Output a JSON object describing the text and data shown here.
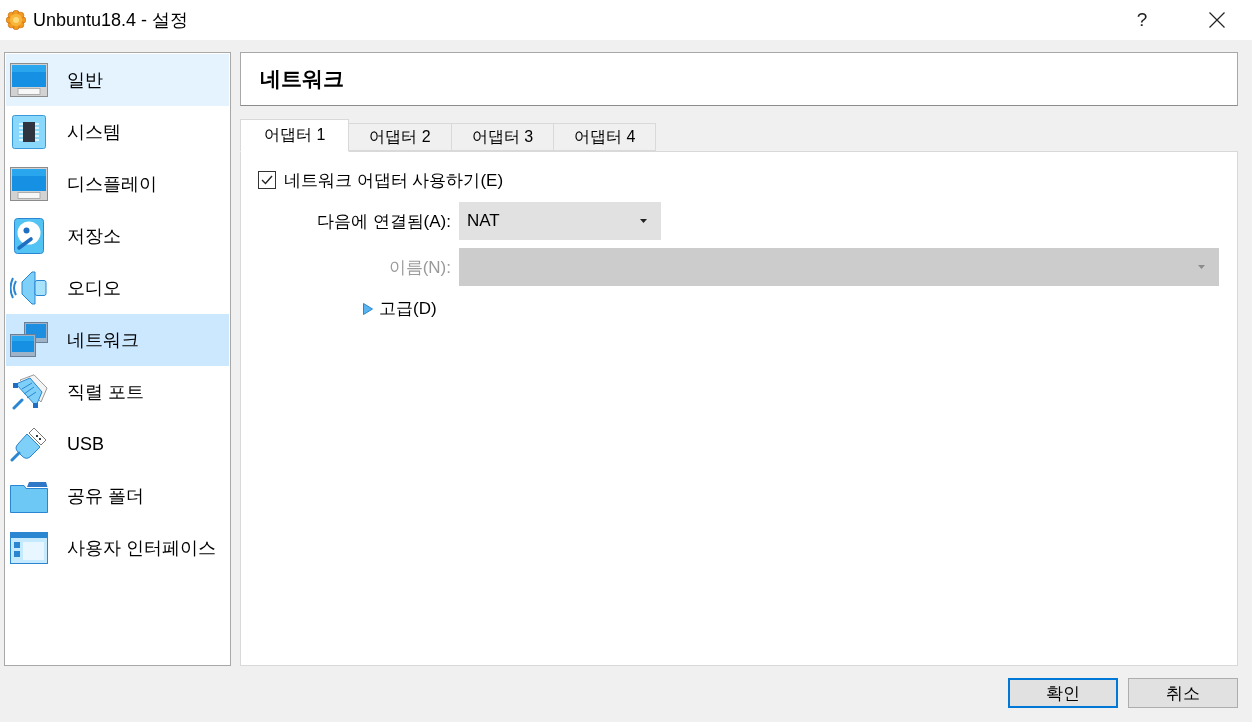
{
  "window": {
    "title": "Unbuntu18.4 - 설정",
    "help": "?"
  },
  "sidebar": {
    "items": [
      {
        "label": "일반",
        "kind": "general",
        "selected": false,
        "hovered": true
      },
      {
        "label": "시스템",
        "kind": "system",
        "selected": false,
        "hovered": false
      },
      {
        "label": "디스플레이",
        "kind": "display",
        "selected": false,
        "hovered": false
      },
      {
        "label": "저장소",
        "kind": "storage",
        "selected": false,
        "hovered": false
      },
      {
        "label": "오디오",
        "kind": "audio",
        "selected": false,
        "hovered": false
      },
      {
        "label": "네트워크",
        "kind": "network",
        "selected": true,
        "hovered": false
      },
      {
        "label": "직렬 포트",
        "kind": "serial",
        "selected": false,
        "hovered": false
      },
      {
        "label": "USB",
        "kind": "usb",
        "selected": false,
        "hovered": false
      },
      {
        "label": "공유 폴더",
        "kind": "shared",
        "selected": false,
        "hovered": false
      },
      {
        "label": "사용자 인터페이스",
        "kind": "interface",
        "selected": false,
        "hovered": false
      }
    ]
  },
  "page": {
    "title": "네트워크"
  },
  "tabs": [
    {
      "label": "어댑터 1",
      "selected": true
    },
    {
      "label": "어댑터 2",
      "selected": false
    },
    {
      "label": "어댑터 3",
      "selected": false
    },
    {
      "label": "어댑터 4",
      "selected": false
    }
  ],
  "adapter": {
    "enabled": {
      "label": "네트워크 어댑터 사용하기(E)",
      "checked": true
    },
    "attached_to": {
      "label": "다음에 연결됨(A):",
      "value": "NAT",
      "disabled": false
    },
    "name": {
      "label": "이름(N):",
      "disabled": true
    },
    "advanced": {
      "label": "고급(D)",
      "expanded": false
    }
  },
  "buttons": [
    {
      "label": "확인",
      "default": true
    },
    {
      "label": "취소",
      "default": false
    }
  ]
}
